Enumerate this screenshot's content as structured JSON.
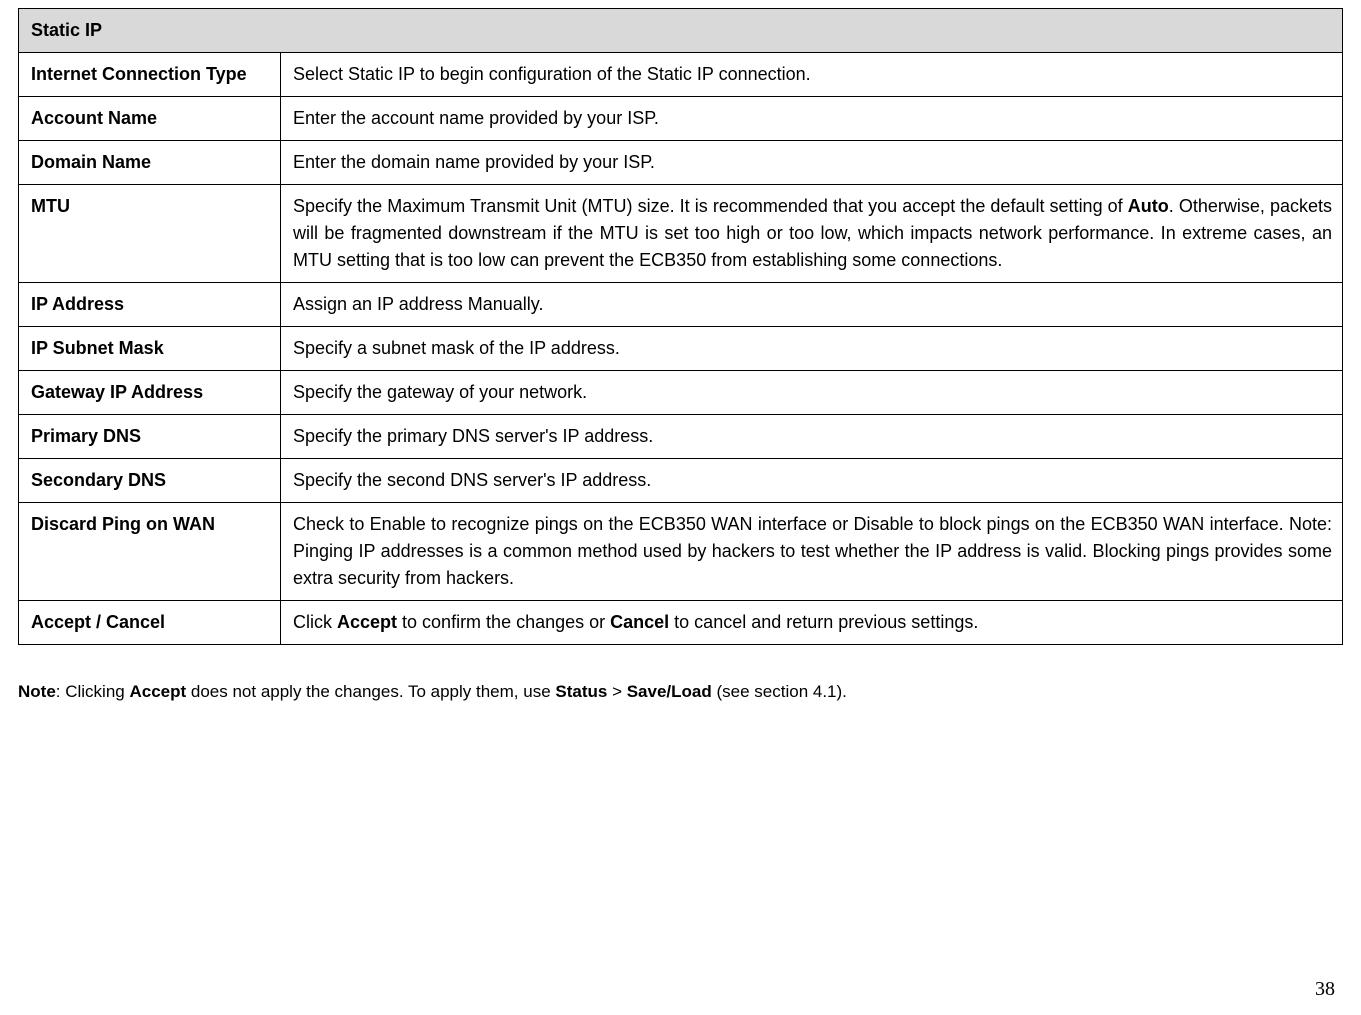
{
  "table": {
    "header": "Static IP",
    "rows": [
      {
        "label": "Internet Connection Type",
        "desc": "Select Static IP to begin configuration of the Static IP connection.",
        "justify": false
      },
      {
        "label": "Account Name",
        "desc": "Enter the account name provided by your ISP.",
        "justify": false
      },
      {
        "label": "Domain Name",
        "desc": "Enter the domain name provided by your ISP.",
        "justify": false
      },
      {
        "label": "MTU",
        "desc_parts": [
          {
            "t": "Specify the Maximum Transmit Unit (MTU) size. It is recommended that you accept the default setting of ",
            "b": false
          },
          {
            "t": "Auto",
            "b": true
          },
          {
            "t": ". Otherwise, packets will be fragmented downstream if the MTU is set too high or too low, which impacts network performance. In extreme cases, an MTU setting that is too low can prevent the ECB350 from establishing some connections.",
            "b": false
          }
        ],
        "justify": true
      },
      {
        "label": "IP Address",
        "desc": "Assign an IP address Manually.",
        "justify": false
      },
      {
        "label": "IP Subnet Mask",
        "desc": "Specify a subnet mask of the IP address.",
        "justify": false
      },
      {
        "label": "Gateway IP Address",
        "desc": "Specify the gateway of your network.",
        "justify": false
      },
      {
        "label": "Primary DNS",
        "desc": "Specify the primary DNS server's IP address.",
        "justify": false
      },
      {
        "label": "Secondary DNS",
        "desc": "Specify the second DNS server's IP address.",
        "justify": false
      },
      {
        "label": "Discard Ping on WAN",
        "desc": "Check to Enable to recognize pings on the ECB350 WAN interface or Disable to block pings on the ECB350 WAN interface. Note: Pinging IP addresses is a common method used by hackers to test whether the IP address is valid. Blocking pings provides some extra security from hackers.",
        "justify": true
      },
      {
        "label": "Accept / Cancel",
        "desc_parts": [
          {
            "t": "Click ",
            "b": false
          },
          {
            "t": "Accept",
            "b": true
          },
          {
            "t": " to confirm the changes or ",
            "b": false
          },
          {
            "t": "Cancel",
            "b": true
          },
          {
            "t": " to cancel and return previous settings.",
            "b": false
          }
        ],
        "justify": false
      }
    ]
  },
  "note_parts": [
    {
      "t": "Note",
      "b": true
    },
    {
      "t": ": Clicking ",
      "b": false
    },
    {
      "t": "Accept",
      "b": true
    },
    {
      "t": " does not apply the changes. To apply them, use ",
      "b": false
    },
    {
      "t": "Status",
      "b": true
    },
    {
      "t": " > ",
      "b": false
    },
    {
      "t": "Save/Load",
      "b": true
    },
    {
      "t": " (see section 4.1).",
      "b": false
    }
  ],
  "page_number": "38"
}
